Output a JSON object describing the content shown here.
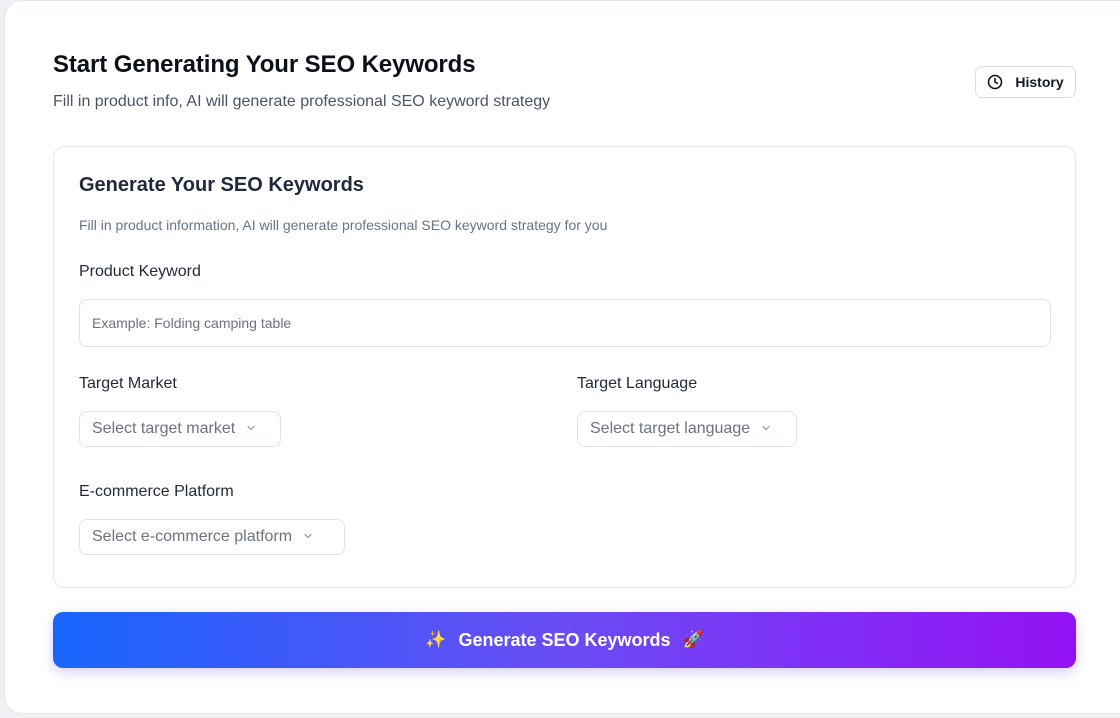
{
  "header": {
    "title": "Start Generating Your SEO Keywords",
    "subtitle": "Fill in product info, AI will generate professional SEO keyword strategy",
    "history_label": "History"
  },
  "form": {
    "title": "Generate Your SEO Keywords",
    "description": "Fill in product information, AI will generate professional SEO keyword strategy for you",
    "product_keyword": {
      "label": "Product Keyword",
      "value": "",
      "placeholder": "Example: Folding camping table"
    },
    "target_market": {
      "label": "Target Market",
      "placeholder": "Select target market"
    },
    "target_language": {
      "label": "Target Language",
      "placeholder": "Select target language"
    },
    "platform": {
      "label": "E-commerce Platform",
      "placeholder": "Select e-commerce platform"
    }
  },
  "generate_button": {
    "label": "Generate SEO Keywords",
    "icon_left": "✨",
    "icon_right": "🚀",
    "gradient_start": "#1766fb",
    "gradient_end": "#9412f4"
  },
  "icons": {
    "history": "clock-icon",
    "select": "chevron-down-icon",
    "sparkles": "sparkles-icon",
    "rocket": "rocket-icon"
  }
}
